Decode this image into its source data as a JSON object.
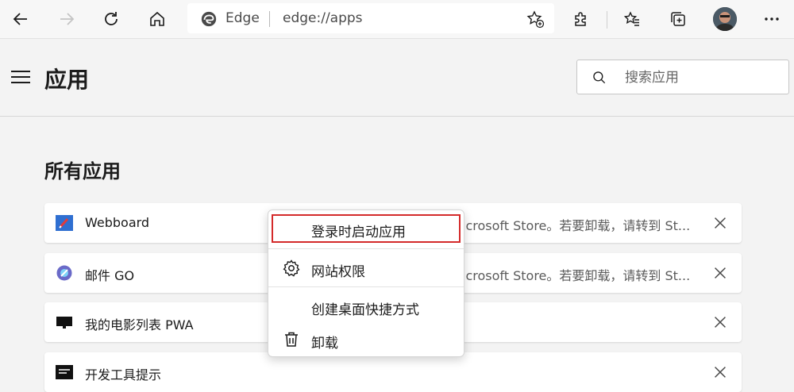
{
  "browser": {
    "brand_label": "Edge",
    "url": "edge://apps",
    "icons": [
      "back-icon",
      "forward-icon",
      "refresh-icon",
      "home-icon",
      "add-favorite-icon",
      "extensions-icon",
      "favorites-icon",
      "collections-icon",
      "more-icon"
    ]
  },
  "header": {
    "title": "应用",
    "search_placeholder": "搜索应用"
  },
  "section": {
    "title": "所有应用"
  },
  "apps": [
    {
      "name": "Webboard",
      "note": "icrosoft Store。若要卸载，请转到 St..."
    },
    {
      "name": "邮件 GO",
      "note": "icrosoft Store。若要卸载，请转到 St..."
    },
    {
      "name": "我的电影列表 PWA",
      "note": ""
    },
    {
      "name": "开发工具提示",
      "note": ""
    }
  ],
  "context_menu": {
    "items": [
      {
        "label": "登录时启动应用",
        "icon": "",
        "focused": true
      },
      {
        "label": "网站权限",
        "icon": "gear-icon"
      },
      {
        "label": "创建桌面快捷方式",
        "icon": ""
      },
      {
        "label": "卸载",
        "icon": "trash-icon"
      }
    ]
  },
  "colors": {
    "focus_outline": "#d42a2a",
    "edge_accent": "#3a3a3a"
  }
}
